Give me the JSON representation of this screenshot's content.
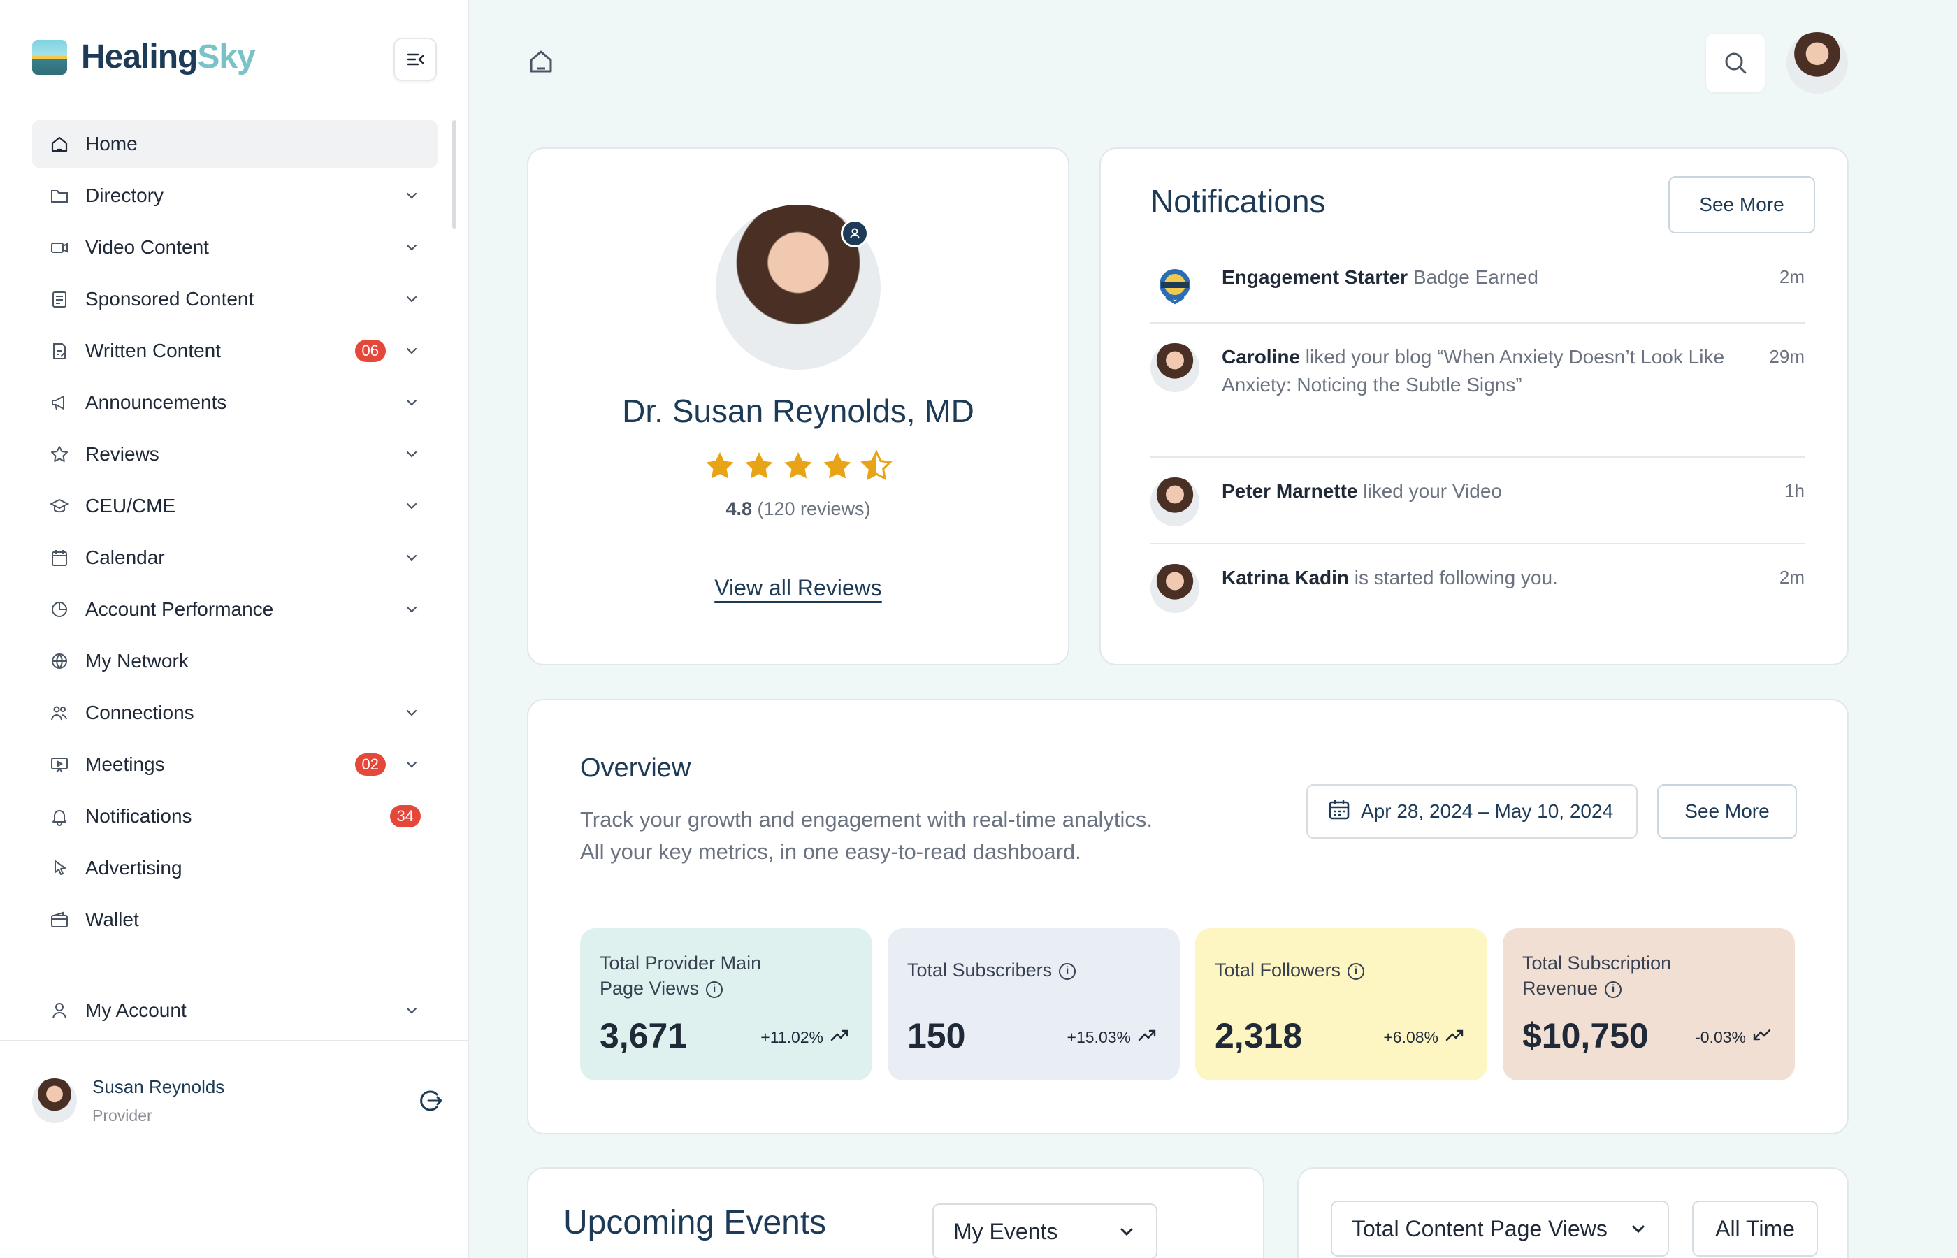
{
  "app": {
    "logo_word1": "Healing",
    "logo_word2": "Sky"
  },
  "sidebar": {
    "items": [
      {
        "label": "Home",
        "icon": "home-icon",
        "active": true,
        "badge": "",
        "chevron": false
      },
      {
        "label": "Directory",
        "icon": "folder-icon",
        "badge": "",
        "chevron": true
      },
      {
        "label": "Video Content",
        "icon": "video-icon",
        "badge": "",
        "chevron": true
      },
      {
        "label": "Sponsored Content",
        "icon": "document-icon",
        "badge": "",
        "chevron": true
      },
      {
        "label": "Written Content",
        "icon": "pen-file-icon",
        "badge": "06",
        "chevron": true
      },
      {
        "label": "Announcements",
        "icon": "megaphone-icon",
        "badge": "",
        "chevron": true
      },
      {
        "label": "Reviews",
        "icon": "star-icon",
        "badge": "",
        "chevron": true
      },
      {
        "label": "CEU/CME",
        "icon": "graduation-cap-icon",
        "badge": "",
        "chevron": true
      },
      {
        "label": "Calendar",
        "icon": "calendar-icon",
        "badge": "",
        "chevron": true
      },
      {
        "label": "Account Performance",
        "icon": "pie-chart-icon",
        "badge": "",
        "chevron": true
      },
      {
        "label": "My Network",
        "icon": "globe-icon",
        "badge": "",
        "chevron": false
      },
      {
        "label": "Connections",
        "icon": "people-icon",
        "badge": "",
        "chevron": true
      },
      {
        "label": "Meetings",
        "icon": "presentation-icon",
        "badge": "02",
        "chevron": true
      },
      {
        "label": "Notifications",
        "icon": "bell-icon",
        "badge": "34",
        "chevron": false
      },
      {
        "label": "Advertising",
        "icon": "cursor-icon",
        "badge": "",
        "chevron": false
      },
      {
        "label": "Wallet",
        "icon": "wallet-icon",
        "badge": "",
        "chevron": false
      }
    ],
    "account": {
      "label": "My Account",
      "icon": "user-icon"
    },
    "user": {
      "name": "Susan Reynolds",
      "role": "Provider"
    }
  },
  "profile": {
    "name": "Dr. Susan Reynolds, MD",
    "rating_value": "4.8",
    "rating_count": " (120 reviews)",
    "stars": 4.5,
    "view_reviews": "View all Reviews"
  },
  "notifications": {
    "title": "Notifications",
    "see_more": "See More",
    "items": [
      {
        "actor": "Engagement Starter",
        "text": " Badge Earned",
        "time": "2m",
        "avatar": "badge-icon"
      },
      {
        "actor": "Caroline",
        "text": " liked your blog “When Anxiety Doesn’t Look Like Anxiety: Noticing the Subtle Signs”",
        "time": "29m",
        "avatar": "avatar"
      },
      {
        "actor": "Peter Marnette",
        "text": " liked your Video",
        "time": "1h",
        "avatar": "avatar"
      },
      {
        "actor": "Katrina Kadin",
        "text": " is started following you.",
        "time": "2m",
        "avatar": "avatar"
      }
    ]
  },
  "overview": {
    "title": "Overview",
    "desc_line1": "Track your growth and engagement with real-time analytics.",
    "desc_line2": "All your key metrics, in one easy-to-read dashboard.",
    "date_range": "Apr 28, 2024 – May 10, 2024",
    "see_more": "See More",
    "metrics": [
      {
        "label": "Total Provider Main Page Views",
        "value": "3,671",
        "delta": "+11.02%",
        "trend": "up",
        "bg": "#dff1ef"
      },
      {
        "label": "Total Subscribers",
        "value": "150",
        "delta": "+15.03%",
        "trend": "up",
        "bg": "#e9eef5"
      },
      {
        "label": "Total Followers",
        "value": "2,318",
        "delta": "+6.08%",
        "trend": "up",
        "bg": "#fdf5c2"
      },
      {
        "label": "Total Subscription Revenue",
        "value": "$10,750",
        "delta": "-0.03%",
        "trend": "down",
        "bg": "#f2dfd3"
      }
    ]
  },
  "events": {
    "title": "Upcoming Events",
    "filter": "My Events"
  },
  "stats": {
    "metric": "Total Content Page Views",
    "range": "All Time"
  },
  "colors": {
    "brand_navy": "#1d3b57",
    "brand_teal": "#79c2c8",
    "badge_red": "#e5473b",
    "star": "#e8a317"
  }
}
